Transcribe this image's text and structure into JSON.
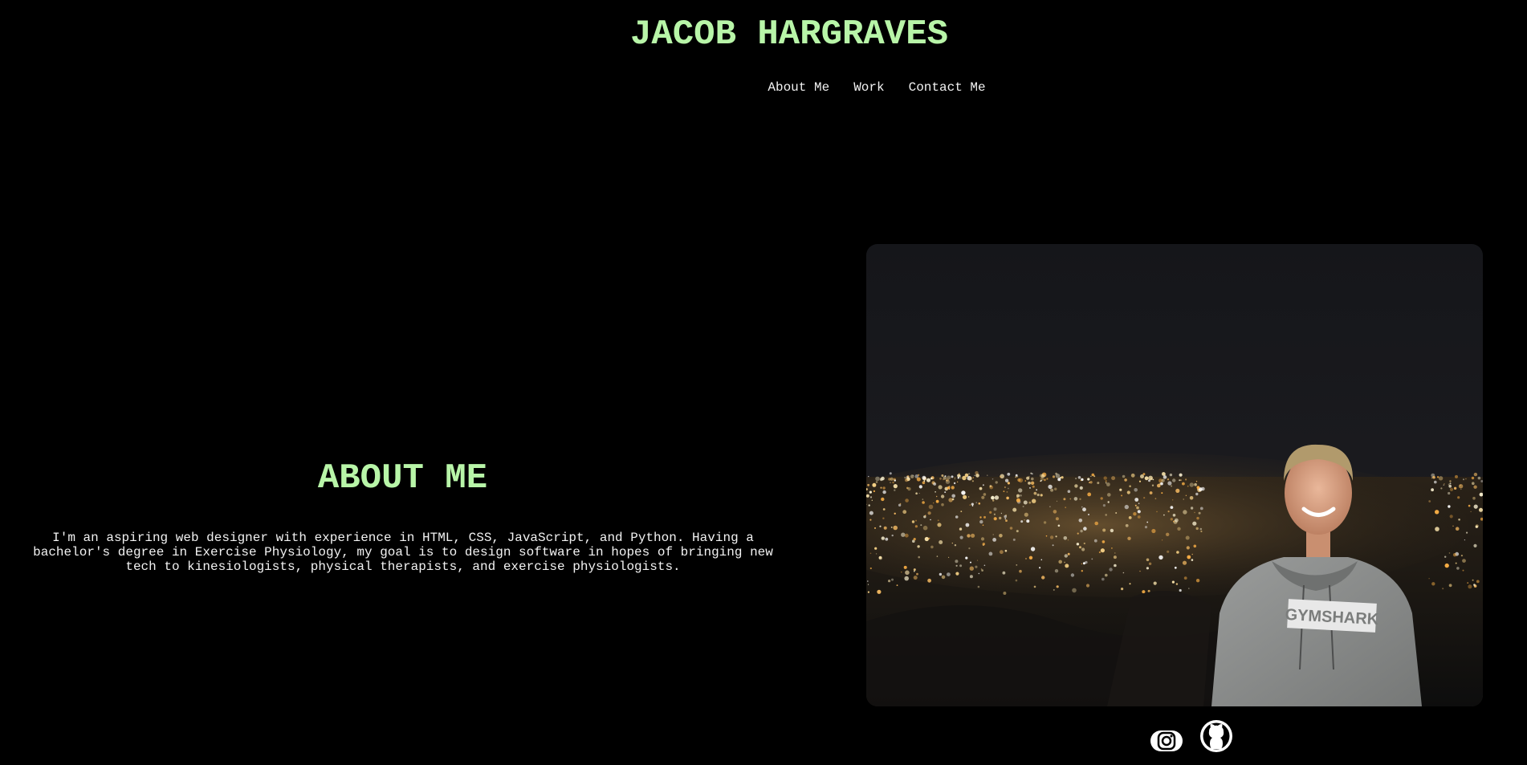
{
  "header": {
    "title": "JACOB HARGRAVES"
  },
  "nav": {
    "items": [
      {
        "label": "About Me"
      },
      {
        "label": "Work"
      },
      {
        "label": "Contact Me"
      }
    ]
  },
  "about": {
    "heading": "ABOUT ME",
    "text": "I'm an aspiring web designer with experience in HTML, CSS, JavaScript, and Python. Having a bachelor's degree in Exercise Physiology, my goal is to design software in hopes of bringing new tech to kinesiologists, physical therapists, and exercise physiologists."
  },
  "photo": {
    "shirt_text": "GYMSHARK"
  },
  "social": {
    "icons": [
      "instagram-icon",
      "github-icon"
    ]
  },
  "colors": {
    "accent": "#b8f5a8",
    "background": "#000000",
    "text": "#f2f2f2"
  }
}
